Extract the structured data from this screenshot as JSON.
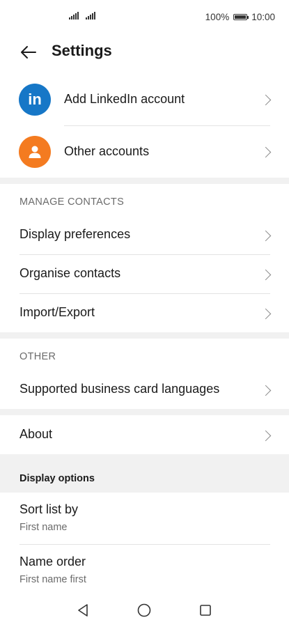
{
  "status_bar": {
    "battery": "100%",
    "time": "10:00"
  },
  "header": {
    "title": "Settings"
  },
  "accounts": [
    {
      "label": "Add LinkedIn account",
      "icon": "linkedin-icon",
      "icon_text": "in",
      "color": "#1677c7"
    },
    {
      "label": "Other accounts",
      "icon": "person-icon",
      "color": "#f47b20"
    }
  ],
  "manage_contacts": {
    "header": "MANAGE CONTACTS",
    "items": [
      {
        "label": "Display preferences"
      },
      {
        "label": "Organise contacts"
      },
      {
        "label": "Import/Export"
      }
    ]
  },
  "other": {
    "header": "OTHER",
    "items": [
      {
        "label": "Supported business card languages"
      }
    ]
  },
  "about": {
    "label": "About"
  },
  "display_options": {
    "header": "Display options",
    "items": [
      {
        "label": "Sort list by",
        "value": "First name"
      },
      {
        "label": "Name order",
        "value": "First name first"
      }
    ]
  },
  "colors": {
    "accent_linkedin": "#1677c7",
    "accent_person": "#f47b20",
    "band": "#f1f1f1"
  }
}
